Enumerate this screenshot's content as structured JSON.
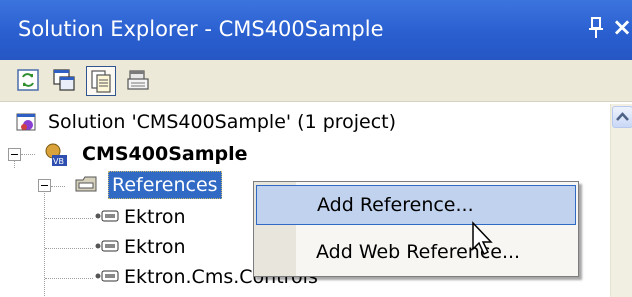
{
  "window": {
    "title": "Solution Explorer - CMS400Sample",
    "pin_icon": "pin-icon",
    "close_label": "×"
  },
  "toolbar": {
    "buttons": [
      {
        "name": "refresh-button",
        "icon": "refresh-icon"
      },
      {
        "name": "view-code-button",
        "icon": "view-code-icon"
      },
      {
        "name": "properties-button",
        "icon": "properties-icon",
        "pressed": true
      },
      {
        "name": "show-all-files-button",
        "icon": "show-all-files-icon"
      }
    ]
  },
  "tree": {
    "solution": {
      "label": "Solution 'CMS400Sample' (1 project)",
      "icon": "solution-icon"
    },
    "project": {
      "label": "CMS400Sample",
      "icon": "vb-project-icon"
    },
    "references": {
      "label": "References",
      "icon": "references-folder-icon",
      "selected": true
    },
    "items": [
      {
        "label": "Ektron",
        "icon": "reference-icon"
      },
      {
        "label": "Ektron",
        "icon": "reference-icon"
      },
      {
        "label": "Ektron.Cms.Controls",
        "icon": "reference-icon"
      }
    ]
  },
  "context_menu": {
    "items": [
      {
        "label": "Add Reference...",
        "hover": true
      },
      {
        "label": "Add Web Reference..."
      }
    ]
  },
  "colors": {
    "titlebar": "#2a5fd0",
    "selection": "#316ac5",
    "menu_hover": "#c1d2ee"
  }
}
